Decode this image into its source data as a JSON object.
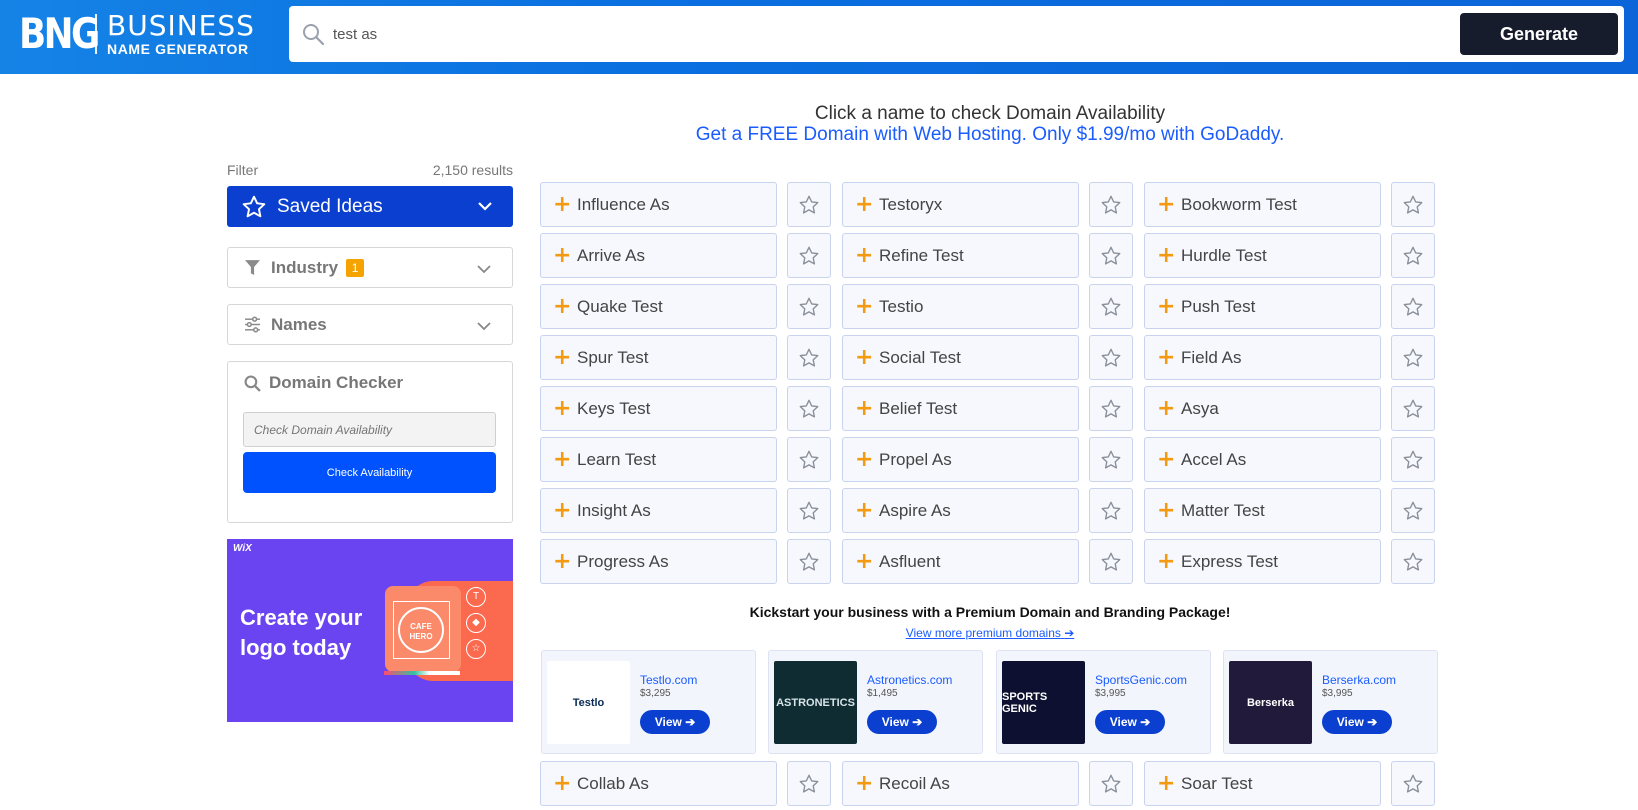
{
  "header": {
    "logo_mark": "BNG",
    "logo_line1": "BUSINESS",
    "logo_line2": "NAME GENERATOR",
    "search_value": "test as",
    "generate_label": "Generate"
  },
  "hint": {
    "line1": "Click a name to check Domain Availability",
    "line2": "Get a FREE Domain with Web Hosting. Only $1.99/mo with GoDaddy."
  },
  "sidebar": {
    "filter_label": "Filter",
    "results_count": "2,150 results",
    "saved_ideas": "Saved Ideas",
    "industry": "Industry",
    "industry_badge": "1",
    "names": "Names",
    "domain_checker": "Domain Checker",
    "domain_placeholder": "Check Domain Availability",
    "check_button": "Check Availability"
  },
  "ad": {
    "brand": "WiX",
    "headline": "Create your logo today",
    "logo_text": "CAFE HERO",
    "dot1": "T",
    "dot2": "◆",
    "dot3": "☆"
  },
  "names": [
    [
      "Influence As",
      "Testoryx",
      "Bookworm Test"
    ],
    [
      "Arrive As",
      "Refine Test",
      "Hurdle Test"
    ],
    [
      "Quake Test",
      "Testio",
      "Push Test"
    ],
    [
      "Spur Test",
      "Social Test",
      "Field As"
    ],
    [
      "Keys Test",
      "Belief Test",
      "Asya"
    ],
    [
      "Learn Test",
      "Propel As",
      "Accel As"
    ],
    [
      "Insight As",
      "Aspire As",
      "Matter Test"
    ],
    [
      "Progress As",
      "Asfluent",
      "Express Test"
    ],
    [
      "Collab As",
      "Recoil As",
      "Soar Test"
    ]
  ],
  "premium": {
    "title": "Kickstart your business with a Premium Domain and Branding Package!",
    "link": "View more premium domains",
    "view_label": "View",
    "cards": [
      {
        "name": "Testlo.com",
        "price": "$3,295",
        "logo": "Testlo",
        "bg": "#ffffff",
        "fg": "#0a2a55"
      },
      {
        "name": "Astronetics.com",
        "price": "$1,495",
        "logo": "ASTRONETICS",
        "bg": "#0f2c33",
        "fg": "#d7e4e7"
      },
      {
        "name": "SportsGenic.com",
        "price": "$3,995",
        "logo": "SPORTS GENIC",
        "bg": "#0d1030",
        "fg": "#ffffff"
      },
      {
        "name": "Berserka.com",
        "price": "$3,995",
        "logo": "Berserka",
        "bg": "#221a3a",
        "fg": "#ffffff"
      }
    ]
  },
  "colors": {
    "accent": "#0a3fd0",
    "plus": "#f49a12",
    "link": "#1a5cff"
  }
}
